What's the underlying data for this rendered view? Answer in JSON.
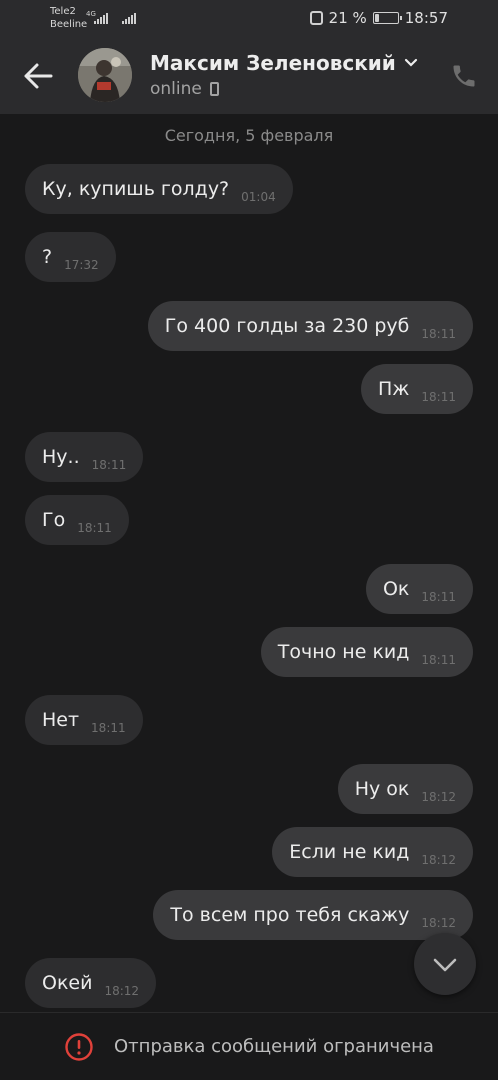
{
  "status_bar": {
    "carrier1": "Tele2",
    "carrier2": "Beeline",
    "network": "4G",
    "battery_percent": "21 %",
    "battery_level": 0.21,
    "time": "18:57"
  },
  "header": {
    "contact_name": "Максим Зеленовский",
    "status": "online"
  },
  "chat": {
    "date": "Сегодня, 5 февраля",
    "messages": [
      {
        "text": "Ку, купишь голду?",
        "time": "01:04",
        "dir": "in"
      },
      {
        "text": "?",
        "time": "17:32",
        "dir": "in"
      },
      {
        "text": "Го 400 голды за 230 руб",
        "time": "18:11",
        "dir": "out"
      },
      {
        "text": "Пж",
        "time": "18:11",
        "dir": "out"
      },
      {
        "text": "Ну..",
        "time": "18:11",
        "dir": "in"
      },
      {
        "text": "Го",
        "time": "18:11",
        "dir": "in"
      },
      {
        "text": "Ок",
        "time": "18:11",
        "dir": "out"
      },
      {
        "text": "Точно не кид",
        "time": "18:11",
        "dir": "out"
      },
      {
        "text": "Нет",
        "time": "18:11",
        "dir": "in"
      },
      {
        "text": "Ну ок",
        "time": "18:12",
        "dir": "out"
      },
      {
        "text": "Если не кид",
        "time": "18:12",
        "dir": "out"
      },
      {
        "text": "То всем про тебя скажу",
        "time": "18:12",
        "dir": "out"
      },
      {
        "text": "Окей",
        "time": "18:12",
        "dir": "in"
      }
    ]
  },
  "footer": {
    "restriction_text": "Отправка сообщений ограничена"
  },
  "colors": {
    "background": "#19191a",
    "bar": "#2b2b2d",
    "bubble_in": "#2d2d2f",
    "bubble_out": "#3a3a3c",
    "warning": "#e0413a"
  },
  "icons": {
    "back": "arrow-left-icon",
    "call": "phone-icon",
    "scroll": "chevron-down-icon",
    "warning": "exclamation-circle-icon"
  }
}
